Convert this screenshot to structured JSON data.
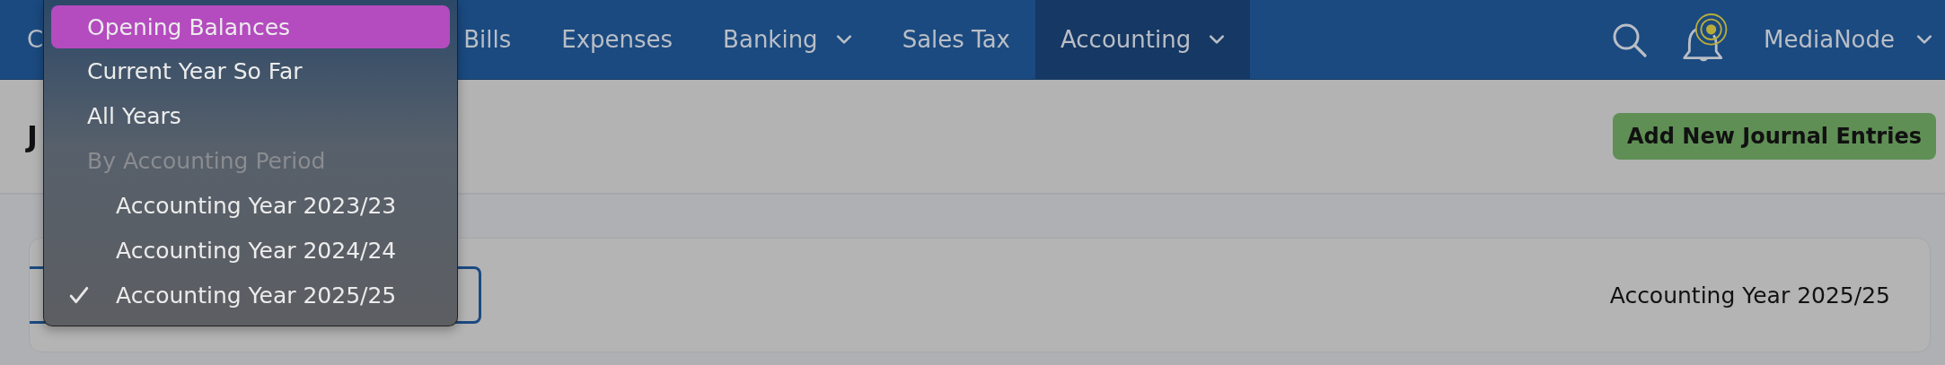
{
  "nav": {
    "items": [
      {
        "label": "C",
        "selected": false,
        "has_menu": false
      },
      {
        "label": "Bills",
        "selected": false,
        "has_menu": false
      },
      {
        "label": "Expenses",
        "selected": false,
        "has_menu": false
      },
      {
        "label": "Banking",
        "selected": false,
        "has_menu": true
      },
      {
        "label": "Sales Tax",
        "selected": false,
        "has_menu": false
      },
      {
        "label": "Accounting",
        "selected": true,
        "has_menu": true
      }
    ],
    "notification": true,
    "user": "MediaNode"
  },
  "page": {
    "title": "J",
    "primary_button": "Add New Journal Entries"
  },
  "filter": {
    "period_label": "Accounting Year 2025/25"
  },
  "period_menu": {
    "items": [
      {
        "label": "Opening Balances",
        "kind": "option",
        "highlighted": true,
        "checked": false
      },
      {
        "label": "Current Year So Far",
        "kind": "option",
        "highlighted": false,
        "checked": false
      },
      {
        "label": "All Years",
        "kind": "option",
        "highlighted": false,
        "checked": false
      },
      {
        "label": "By Accounting Period",
        "kind": "header"
      },
      {
        "label": "Accounting Year 2023/23",
        "kind": "sub",
        "highlighted": false,
        "checked": false
      },
      {
        "label": "Accounting Year 2024/24",
        "kind": "sub",
        "highlighted": false,
        "checked": false
      },
      {
        "label": "Accounting Year 2025/25",
        "kind": "sub",
        "highlighted": false,
        "checked": true
      }
    ]
  }
}
